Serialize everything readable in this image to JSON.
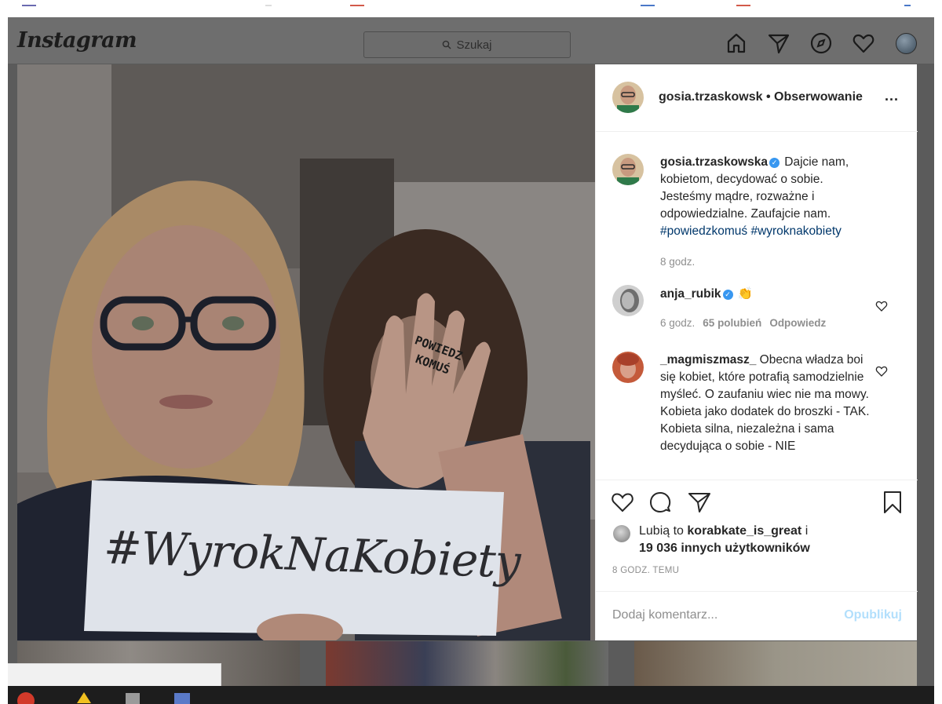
{
  "app": {
    "logo": "Instagram"
  },
  "search": {
    "placeholder": "Szukaj",
    "icon": "search-icon"
  },
  "nav_icons": [
    "home-icon",
    "direct-icon",
    "explore-icon",
    "activity-heart-icon",
    "profile-avatar"
  ],
  "post": {
    "photo_alt": "Two women, one holding a sign, the other raising a hand with writing",
    "sign_text": "#WyrokNaKobiety",
    "hand_text": "POWIEDZ KOMUŚ"
  },
  "header": {
    "username": "gosia.trzaskowsk",
    "separator": " • ",
    "follow_status": "Obserwowanie",
    "more": "..."
  },
  "comments": [
    {
      "user": "gosia.trzaskowska",
      "verified": true,
      "text": " Dajcie nam, kobietom, decydować o sobie. Jesteśmy mądre, rozważne i odpowiedzialne. Zaufajcie nam. ",
      "hashtags": "#powiedzkomuś #wyroknakobiety",
      "meta_time": "8 godz."
    },
    {
      "user": "anja_rubik",
      "verified": true,
      "text": " 👏",
      "meta_time": "6 godz.",
      "meta_likes": "65 polubień",
      "meta_reply": "Odpowiedz"
    },
    {
      "user": "_magmiszmasz_",
      "verified": false,
      "text": " Obecna władza boi się kobiet, które potrafią samodzielnie myśleć. O zaufaniu wiec nie ma mowy. Kobieta jako dodatek do broszki - TAK. Kobieta silna, niezależna i sama decydująca o sobie - NIE"
    }
  ],
  "actions": {
    "icons": [
      "like-heart-icon",
      "comment-bubble-icon",
      "share-paperplane-icon",
      "save-bookmark-icon"
    ],
    "likes_prefix": "Lubią to ",
    "likes_user": "korabkate_is_great",
    "likes_mid": " i",
    "likes_count": "19 036 innych użytkowników",
    "time": "8 GODZ. TEMU"
  },
  "comment_input": {
    "placeholder": "Dodaj komentarz...",
    "publish": "Opublikuj"
  },
  "colors": {
    "link": "#00376b",
    "verified": "#3897f0",
    "publish_disabled": "#b2dffc",
    "overlay": "#5b5b5b"
  }
}
